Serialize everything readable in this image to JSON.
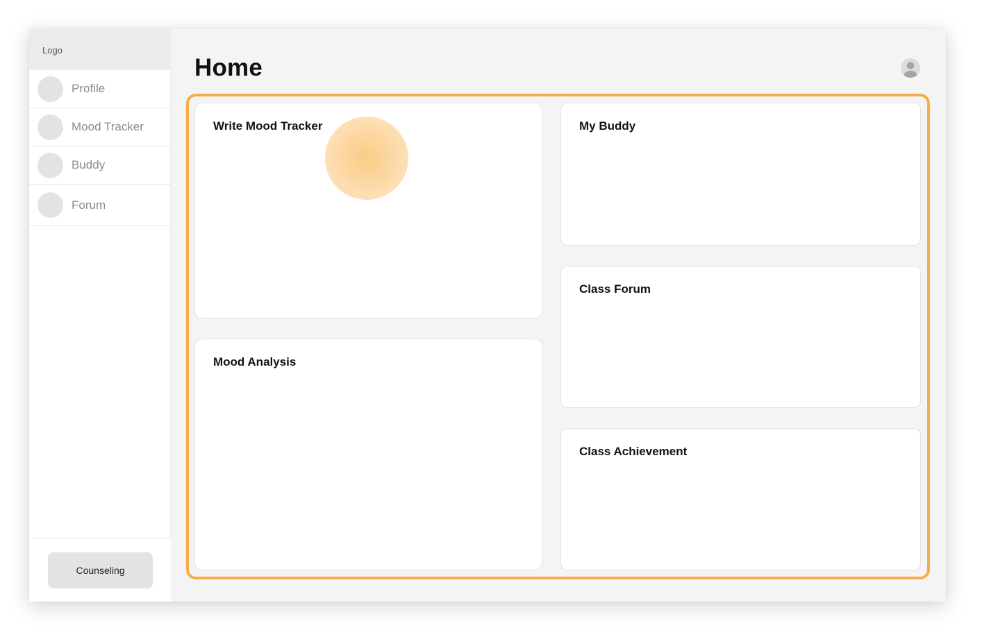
{
  "sidebar": {
    "logo": "Logo",
    "items": [
      {
        "label": "Profile"
      },
      {
        "label": "Mood Tracker"
      },
      {
        "label": "Buddy"
      },
      {
        "label": "Forum"
      }
    ],
    "footer_button": "Counseling"
  },
  "header": {
    "title": "Home"
  },
  "cards": {
    "write_mood_tracker": "Write Mood Tracker",
    "mood_analysis": "Mood Analysis",
    "my_buddy": "My Buddy",
    "class_forum": "Class Forum",
    "class_achievement": "Class Achievement"
  },
  "colors": {
    "highlight_border": "#f7ac46",
    "touch_indicator": "#fcc880",
    "placeholder_gray": "#e3e3e3"
  }
}
